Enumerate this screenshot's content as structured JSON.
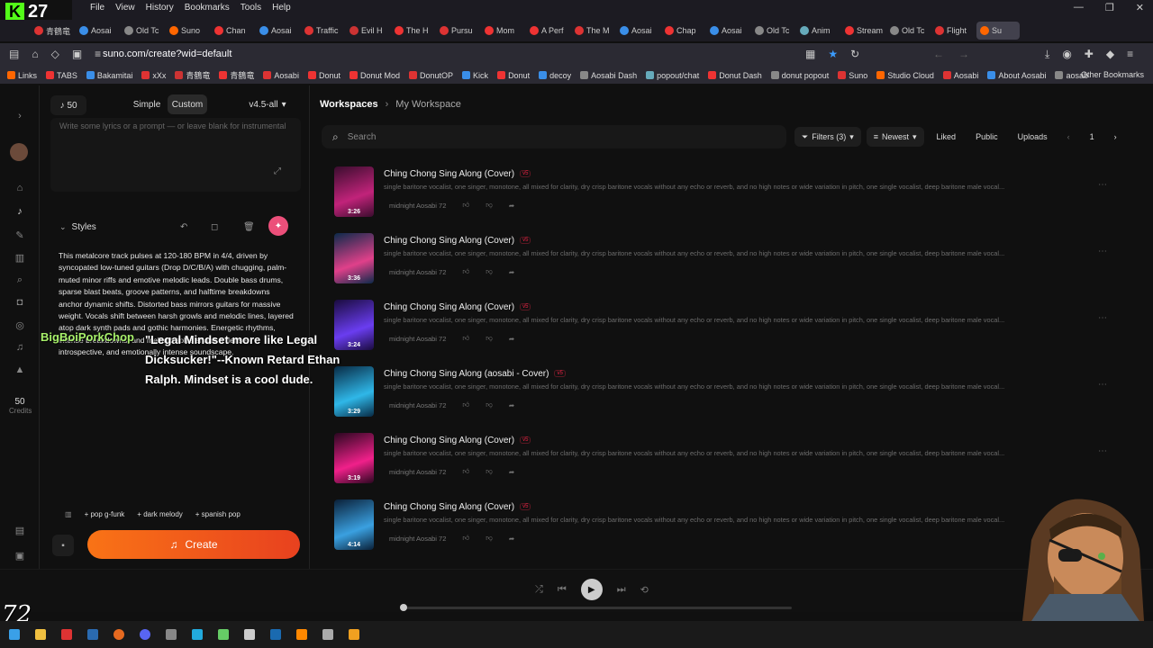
{
  "browser": {
    "stream_counter": "27",
    "menus": [
      "File",
      "View",
      "History",
      "Bookmarks",
      "Tools",
      "Help"
    ],
    "tabs": [
      "青鶴竜",
      "Aosai",
      "Old Tc",
      "Suno",
      "Chan",
      "Aosai",
      "Traffic",
      "Evil H",
      "The H",
      "Pursu",
      "Mom",
      "A Perf",
      "The M",
      "Aosai",
      "Chap",
      "Aosai",
      "Old Tc",
      "Anim",
      "Stream",
      "Old Tc",
      "Flight",
      "Su"
    ],
    "url": "suno.com/create?wid=default",
    "bookmarks": [
      "Links",
      "TABS",
      "Bakamitai",
      "xXx",
      "青鶴竜",
      "青鶴竜",
      "Aosabi",
      "Donut",
      "Donut Mod",
      "DonutOP",
      "Kick",
      "Donut",
      "decoy",
      "Aosabi Dash",
      "popout/chat",
      "Donut Dash",
      "donut popout",
      "Suno",
      "Studio Cloud",
      "Aosabi",
      "About Aosabi",
      "aosab"
    ],
    "other_bookmarks": "Other Bookmarks"
  },
  "rail": {
    "credits_value": "50",
    "credits_label": "Credits"
  },
  "create": {
    "count": "50",
    "mode_simple": "Simple",
    "mode_custom": "Custom",
    "model": "v4.5-all",
    "lyrics_placeholder": "Write some lyrics or a prompt — or leave blank for instrumental",
    "styles_label": "Styles",
    "styles_text": "This metalcore track pulses at 120-180 BPM in 4/4, driven by syncopated low-tuned guitars (Drop D/C/B/A) with chugging, palm-muted minor riffs and emotive melodic leads. Double bass drums, sparse blast beats, groove patterns, and halftime breakdowns anchor dynamic shifts. Distorted bass mirrors guitars for massive weight. Vocals shift between harsh growls and melodic lines, layered atop dark synth pads and gothic harmonies. Energetic rhythms, intense breakdowns, and melodic solos shape a dense, introspective, and emotionally intense soundscape.",
    "tags": [
      "pop g-funk",
      "dark melody",
      "spanish pop"
    ],
    "create_label": "Create"
  },
  "overlay": {
    "user": "BigBoiPorkChop",
    "message": "\"Legal Mindset more like Legal Dicksucker!\"--Known Retard Ethan Ralph. Mindset is a cool dude."
  },
  "workspace": {
    "crumb_root": "Workspaces",
    "crumb_current": "My Workspace",
    "search_placeholder": "Search",
    "filters": "Filters (3)",
    "sort": "Newest",
    "liked": "Liked",
    "public": "Public",
    "uploads": "Uploads",
    "page": "1"
  },
  "songs": [
    {
      "title": "Ching Chong Sing Along (Cover)",
      "version": "v5",
      "desc": "single baritone vocalist, one singer, monotone, all mixed for clarity, dry crisp baritone vocals without any echo or reverb, and no high notes or wide variation in pitch, one single vocalist, deep baritone male vocal...",
      "artist": "midnight Aosabi 72",
      "duration": "3:26",
      "colors": [
        "#3a0d2e",
        "#c1237a"
      ]
    },
    {
      "title": "Ching Chong Sing Along (Cover)",
      "version": "v5",
      "desc": "single baritone vocalist, one singer, monotone, all mixed for clarity, dry crisp baritone vocals without any echo or reverb, and no high notes or wide variation in pitch, one single vocalist, deep baritone male vocal...",
      "artist": "midnight Aosabi 72",
      "duration": "3:36",
      "colors": [
        "#0b2a4a",
        "#e0408a"
      ]
    },
    {
      "title": "Ching Chong Sing Along (Cover)",
      "version": "v5",
      "desc": "single baritone vocalist, one singer, monotone, all mixed for clarity, dry crisp baritone vocals without any echo or reverb, and no high notes or wide variation in pitch, one single vocalist, deep baritone male vocal...",
      "artist": "midnight Aosabi 72",
      "duration": "3:24",
      "colors": [
        "#1a0b3e",
        "#6a3df0"
      ]
    },
    {
      "title": "Ching Chong Sing Along (aosabi - Cover)",
      "version": "v5",
      "desc": "single baritone vocalist, one singer, monotone, all mixed for clarity, dry crisp baritone vocals without any echo or reverb, and no high notes or wide variation in pitch, one single vocalist, deep baritone male vocal...",
      "artist": "midnight Aosabi 72",
      "duration": "3:29",
      "colors": [
        "#082a44",
        "#2fb7e8"
      ]
    },
    {
      "title": "Ching Chong Sing Along (Cover)",
      "version": "v5",
      "desc": "single baritone vocalist, one singer, monotone, all mixed for clarity, dry crisp baritone vocals without any echo or reverb, and no high notes or wide variation in pitch, one single vocalist, deep baritone male vocal...",
      "artist": "midnight Aosabi 72",
      "duration": "3:19",
      "colors": [
        "#2a0720",
        "#f0208a"
      ]
    },
    {
      "title": "Ching Chong Sing Along (Cover)",
      "version": "v5",
      "desc": "single baritone vocalist, one singer, monotone, all mixed for clarity, dry crisp baritone vocals without any echo or reverb, and no high notes or wide variation in pitch, one single vocalist, deep baritone male vocal...",
      "artist": "midnight Aosabi 72",
      "duration": "4:14",
      "colors": [
        "#0a2038",
        "#3aa0e0"
      ]
    }
  ],
  "stream_overlay_tag": "72",
  "colors": {
    "accent": "#f97316",
    "create_end": "#e8411f",
    "magic": "#ec4f7a"
  }
}
